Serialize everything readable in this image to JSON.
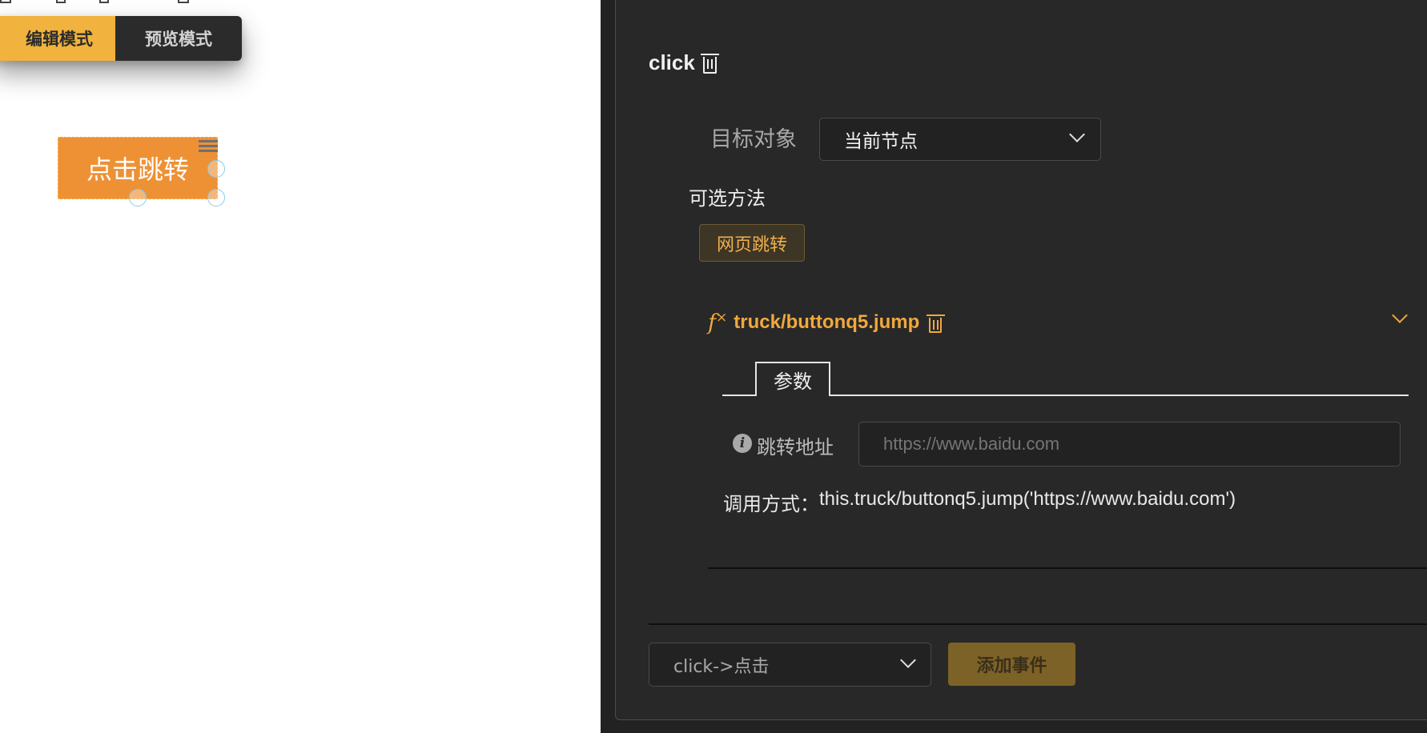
{
  "mode_switch": {
    "edit_label": "编辑模式",
    "preview_label": "预览模式",
    "active": "edit",
    "active_color": "#f1b33d"
  },
  "canvas": {
    "button_text": "点击跳转",
    "button_color": "#ee9135"
  },
  "event": {
    "name": "click",
    "target_label": "目标对象",
    "target_value": "当前节点",
    "methods_label": "可选方法",
    "method_tags": [
      "网页跳转"
    ],
    "function": {
      "icon": "function-icon",
      "name": "truck/buttonq5.jump",
      "tab_label": "参数",
      "param_label": "跳转地址",
      "param_placeholder": "https://www.baidu.com",
      "call_label": "调用方式：",
      "call_code": "this.truck/buttonq5.jump('https://www.baidu.com')"
    }
  },
  "footer": {
    "event_select_value": "click->点击",
    "add_button_label": "添加事件"
  },
  "colors": {
    "accent": "#f1a83d",
    "panel_bg": "#282828",
    "add_button_bg": "#7d6227"
  }
}
